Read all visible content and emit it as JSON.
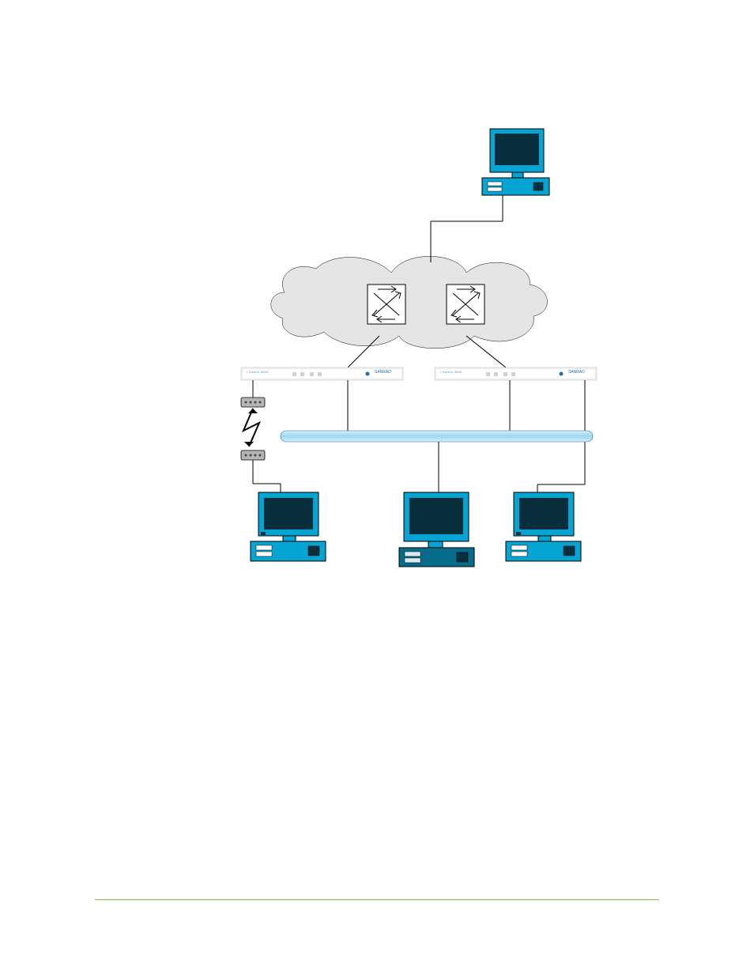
{
  "devices": {
    "top_label": "i Switch 3000",
    "brand": "SANRAD",
    "switch_a": {
      "front_text": "i Switch 3000",
      "brand": "SANRAD"
    },
    "switch_b": {
      "front_text": "i Switch 3000",
      "brand": "SANRAD"
    }
  }
}
